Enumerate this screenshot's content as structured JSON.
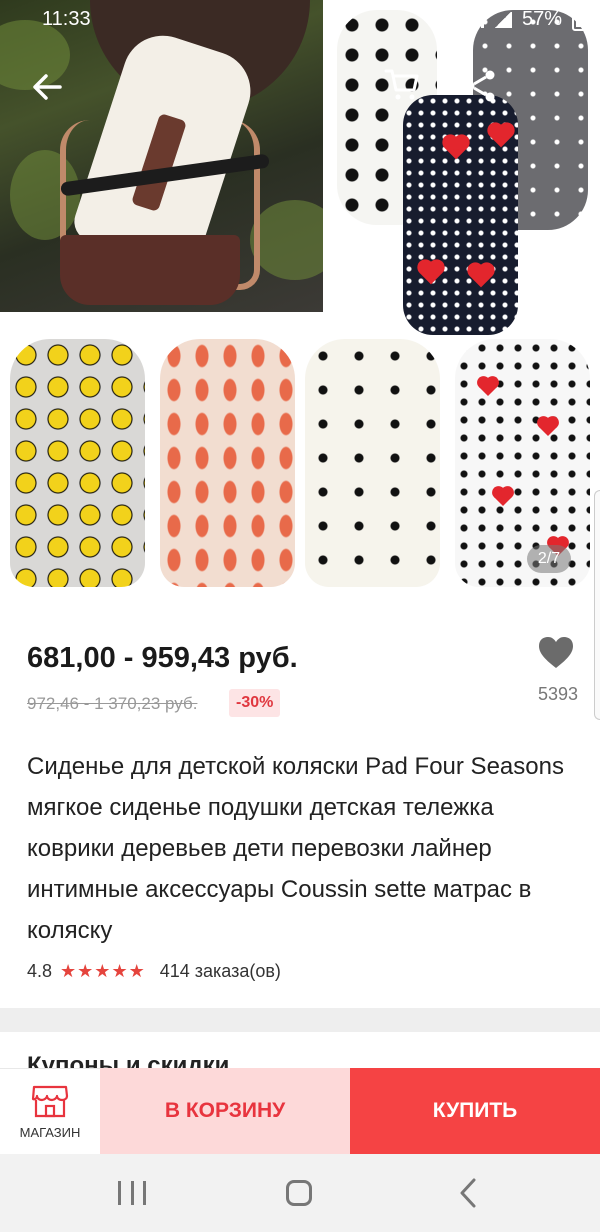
{
  "status_bar": {
    "time": "11:33",
    "battery": "57%"
  },
  "gallery": {
    "counter": "2/7"
  },
  "price": {
    "current": "681,00 - 959,43 руб.",
    "original": "972,46 - 1 370,23 руб.",
    "discount": "-30%"
  },
  "favorites": {
    "count": "5393"
  },
  "product": {
    "title": "Сиденье для детской коляски Pad Four Seasons мягкое сиденье подушки детская тележка коврики деревьев дети перевозки лайнер интимные аксессуары Coussin sette матрас в коляску",
    "rating": "4.8",
    "stars": "★★★★★",
    "orders": "414 заказа(ов)"
  },
  "next_section": {
    "heading": "Купоны и скидки"
  },
  "action_bar": {
    "store_label": "МАГАЗИН",
    "add_to_cart": "В КОРЗИНУ",
    "buy": "КУПИТЬ"
  },
  "colors": {
    "accent": "#f54344",
    "accent_light": "#fdd9d9",
    "star": "#e5443d"
  },
  "icons": [
    "back-arrow-icon",
    "cart-icon",
    "share-icon",
    "heart-icon",
    "store-icon",
    "nav-recent-icon",
    "nav-home-icon",
    "nav-back-icon"
  ]
}
